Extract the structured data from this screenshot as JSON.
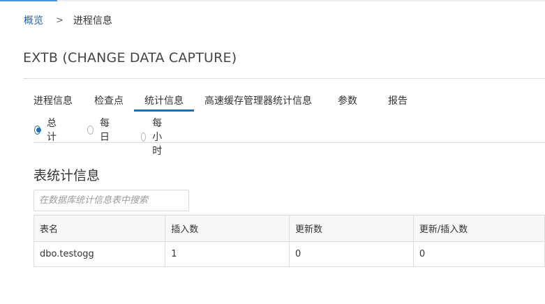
{
  "breadcrumb": {
    "home": "概览",
    "separator": ">",
    "current": "进程信息"
  },
  "page_title": "EXTB (CHANGE DATA CAPTURE)",
  "tabs": [
    {
      "label": "进程信息",
      "active": false
    },
    {
      "label": "检查点",
      "active": false
    },
    {
      "label": "统计信息",
      "active": true
    },
    {
      "label": "高速缓存管理器统计信息",
      "active": false
    },
    {
      "label": "参数",
      "active": false
    },
    {
      "label": "报告",
      "active": false
    }
  ],
  "interval_options": [
    {
      "label": "总计",
      "checked": true
    },
    {
      "label": "每日",
      "checked": false
    },
    {
      "label": "每小时",
      "checked": false
    }
  ],
  "table_section": {
    "title": "表统计信息",
    "search_placeholder": "在数据库统计信息表中搜索",
    "columns": [
      "表名",
      "插入数",
      "更新数",
      "更新/插入数"
    ],
    "rows": [
      [
        "dbo.testogg",
        "1",
        "0",
        "0"
      ]
    ]
  },
  "colors": {
    "accent": "#1f6fb3",
    "link": "#1f5f9f",
    "border": "#dcdcdc",
    "header_bg": "#f7f7f7"
  }
}
